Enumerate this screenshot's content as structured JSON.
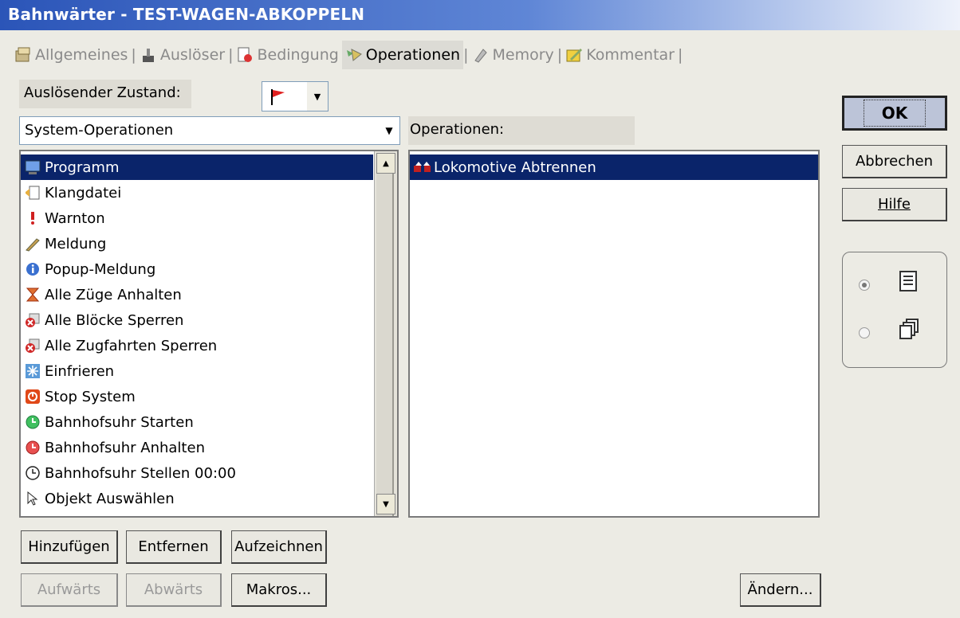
{
  "window": {
    "title": "Bahnwärter - TEST-WAGEN-ABKOPPELN"
  },
  "tabs": [
    {
      "label": "Allgemeines",
      "icon": "general-icon",
      "active": false
    },
    {
      "label": "Auslöser",
      "icon": "trigger-icon",
      "active": false
    },
    {
      "label": "Bedingung",
      "icon": "condition-icon",
      "active": false
    },
    {
      "label": "Operationen",
      "icon": "operations-icon",
      "active": true
    },
    {
      "label": "Memory",
      "icon": "memory-icon",
      "active": false
    },
    {
      "label": "Kommentar",
      "icon": "comment-icon",
      "active": false
    }
  ],
  "trigger_state": {
    "label": "Auslösender Zustand:",
    "value_icon": "red-flag-icon"
  },
  "category_select": {
    "value": "System-Operationen"
  },
  "operations_header": {
    "label": "Operationen:"
  },
  "available_list": [
    {
      "label": "Programm",
      "icon": "program-icon",
      "selected": true
    },
    {
      "label": "Klangdatei",
      "icon": "sound-file-icon",
      "selected": false
    },
    {
      "label": "Warnton",
      "icon": "warning-tone-icon",
      "selected": false
    },
    {
      "label": "Meldung",
      "icon": "message-icon",
      "selected": false
    },
    {
      "label": "Popup-Meldung",
      "icon": "popup-info-icon",
      "selected": false
    },
    {
      "label": "Alle Züge Anhalten",
      "icon": "hourglass-icon",
      "selected": false
    },
    {
      "label": "Alle Blöcke Sperren",
      "icon": "block-lock-icon",
      "selected": false
    },
    {
      "label": "Alle Zugfahrten Sperren",
      "icon": "route-lock-icon",
      "selected": false
    },
    {
      "label": "Einfrieren",
      "icon": "freeze-icon",
      "selected": false
    },
    {
      "label": "Stop System",
      "icon": "stop-icon",
      "selected": false
    },
    {
      "label": "Bahnhofsuhr Starten",
      "icon": "clock-start-icon",
      "selected": false
    },
    {
      "label": "Bahnhofsuhr Anhalten",
      "icon": "clock-stop-icon",
      "selected": false
    },
    {
      "label": "Bahnhofsuhr Stellen 00:00",
      "icon": "clock-set-icon",
      "selected": false
    },
    {
      "label": "Objekt Auswählen",
      "icon": "cursor-icon",
      "selected": false
    }
  ],
  "operations_list": [
    {
      "label": "Lokomotive Abtrennen",
      "icon": "locomotive-detach-icon",
      "selected": true
    }
  ],
  "buttons": {
    "ok": "OK",
    "cancel": "Abbrechen",
    "help": "Hilfe",
    "add": "Hinzufügen",
    "remove": "Entfernen",
    "record": "Aufzeichnen",
    "up": "Aufwärts",
    "down": "Abwärts",
    "macros": "Makros...",
    "change": "Ändern..."
  },
  "view_options": [
    {
      "icon": "list-view-icon",
      "selected": true
    },
    {
      "icon": "multi-page-view-icon",
      "selected": false
    }
  ]
}
